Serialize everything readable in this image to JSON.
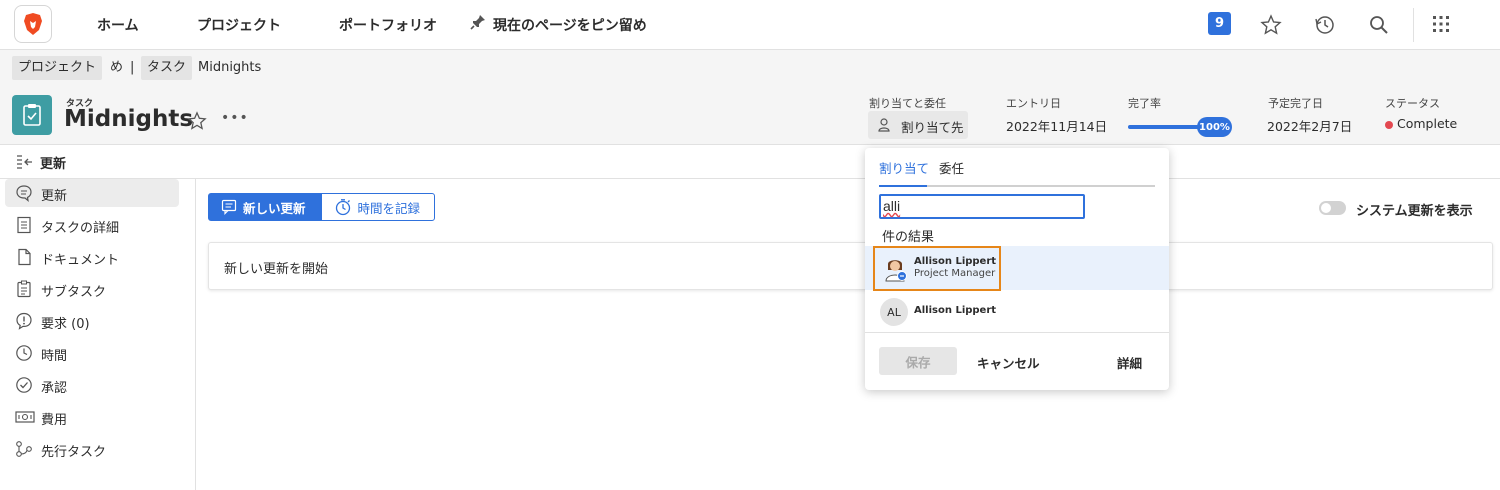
{
  "nav": {
    "home": "ホーム",
    "projects": "プロジェクト",
    "portfolios": "ポートフォリオ",
    "pin_page": "現在のページをピン留め",
    "notification_count": "9"
  },
  "breadcrumb": {
    "project_chip": "プロジェクト",
    "project_name": "め",
    "separator": "|",
    "task_chip": "タスク",
    "task_name": "Midnights"
  },
  "header": {
    "object_type": "タスク",
    "title": "Midnights",
    "more": "•••"
  },
  "meta": {
    "assign_label": "割り当てと委任",
    "assign_value": "割り当て先",
    "entry_label": "エントリ日",
    "entry_value": "2022年11月14日",
    "complete_label": "完了率",
    "complete_value": "100%",
    "complete_fraction": 1.0,
    "due_label": "予定完了日",
    "due_value": "2022年2月7日",
    "status_label": "ステータス",
    "status_value": "Complete",
    "status_color": "#e34850"
  },
  "section": {
    "title": "更新"
  },
  "sidebar": {
    "items": [
      {
        "label": "更新",
        "icon": "chat-bubble-icon"
      },
      {
        "label": "タスクの詳細",
        "icon": "document-lines-icon"
      },
      {
        "label": "ドキュメント",
        "icon": "file-icon"
      },
      {
        "label": "サブタスク",
        "icon": "checklist-icon"
      },
      {
        "label": "要求 (0)",
        "icon": "alert-bubble-icon"
      },
      {
        "label": "時間",
        "icon": "clock-icon"
      },
      {
        "label": "承認",
        "icon": "check-circle-icon"
      },
      {
        "label": "費用",
        "icon": "money-icon"
      },
      {
        "label": "先行タスク",
        "icon": "predecessor-icon"
      }
    ]
  },
  "main": {
    "new_update_btn": "新しい更新",
    "log_time_btn": "時間を記録",
    "start_update": "新しい更新を開始",
    "show_system_updates": "システム更新を表示"
  },
  "popup": {
    "tab_assign": "割り当て",
    "tab_delegate": "委任",
    "search_value": "alli",
    "results_heading": "件の結果",
    "results": [
      {
        "name": "Allison Lippert",
        "role": "Project Manager"
      },
      {
        "name": "Allison Lippert",
        "initials": "AL"
      }
    ],
    "save": "保存",
    "cancel": "キャンセル",
    "details": "詳細"
  },
  "colors": {
    "accent": "#2f71dc",
    "task_icon": "#3e9da3",
    "highlight_border": "#e68619"
  }
}
